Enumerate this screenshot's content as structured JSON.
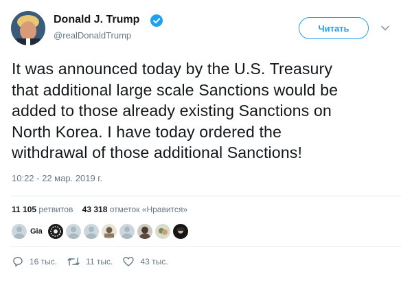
{
  "user": {
    "name": "Donald J. Trump",
    "handle": "@realDonaldTrump",
    "verified": true,
    "avatar_icon": "user-avatar"
  },
  "follow_button": {
    "label": "Читать"
  },
  "menu": {
    "icon": "chevron-down-icon"
  },
  "tweet": {
    "lines": [
      "It was announced today by the U.S. Treasury",
      "that additional large scale Sanctions would be",
      "added to those already existing Sanctions on",
      "North Korea. I have today ordered the",
      "withdrawal of those additional Sanctions!"
    ],
    "timestamp": "10:22 - 22 мар. 2019 г."
  },
  "stats": {
    "retweets_count": "11 105",
    "retweets_label": "ретвитов",
    "likes_count": "43 318",
    "likes_label": "отметок «Нравится»"
  },
  "likers": {
    "first_label": "Gia",
    "count_shown": 8
  },
  "actions": {
    "reply_count": "16 тыс.",
    "retweet_count": "11 тыс.",
    "like_count": "43 тыс."
  },
  "colors": {
    "accent": "#1da1f2",
    "secondary_text": "#657786",
    "divider": "#e6ecf0"
  }
}
